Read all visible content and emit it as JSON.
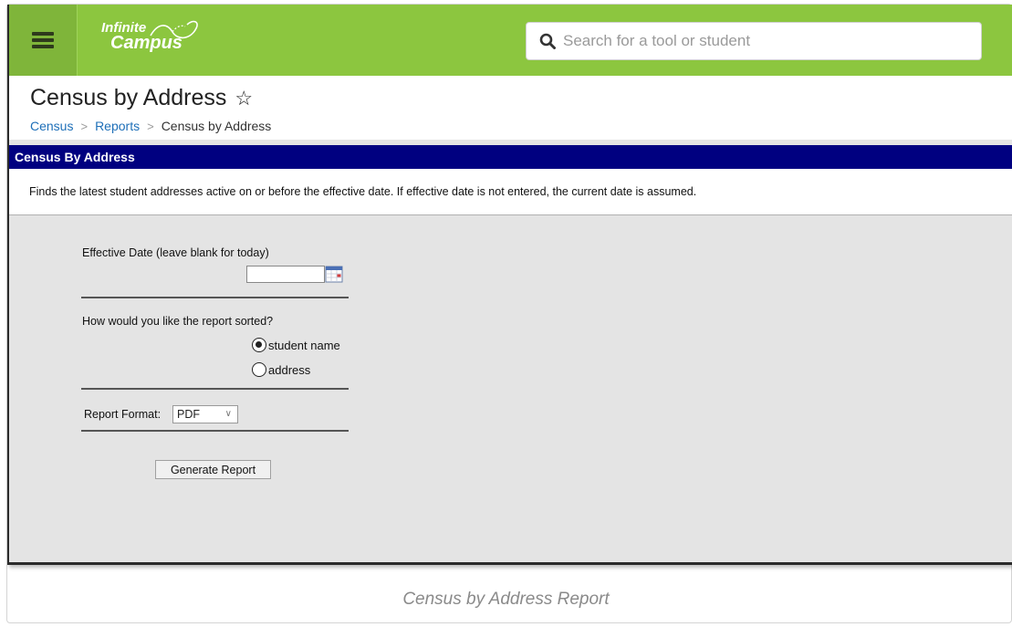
{
  "topbar": {
    "logo_line1": "Infinite",
    "logo_line2": "Campus",
    "search_placeholder": "Search for a tool or student",
    "brand_color": "#8cc63f"
  },
  "page": {
    "title": "Census by Address",
    "star_icon": "☆",
    "breadcrumb": [
      {
        "label": "Census"
      },
      {
        "label": "Reports"
      },
      {
        "label": "Census by Address"
      }
    ],
    "breadcrumb_sep": ">"
  },
  "panel": {
    "title": "Census By Address",
    "description": "Finds the latest student addresses active on or before the effective date. If effective date is not entered, the current date is assumed.",
    "header_color": "#000080"
  },
  "form": {
    "effective_date_label": "Effective Date (leave blank for today)",
    "effective_date_value": "",
    "sort_question": "How would you like the report sorted?",
    "sort_options": [
      {
        "label": "student name",
        "selected": true
      },
      {
        "label": "address",
        "selected": false
      }
    ],
    "report_format_label": "Report Format:",
    "report_format_value": "PDF",
    "generate_button": "Generate Report"
  },
  "caption": "Census by Address Report"
}
